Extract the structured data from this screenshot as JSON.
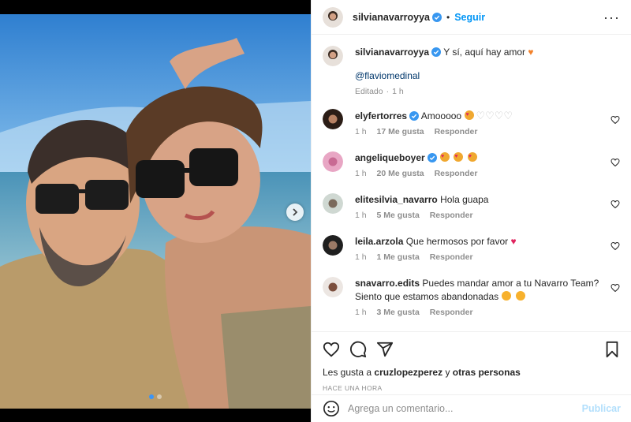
{
  "post": {
    "author": "silvianavarroyya",
    "follow_label": "Seguir",
    "separator": "•",
    "more_label": "···"
  },
  "caption": {
    "author": "silvianavarroyya",
    "text": "Y sí, aquí hay amor",
    "emoji": "orange-heart",
    "mention": "@flaviomedinal",
    "edited_label": "Editado",
    "time": "1 h"
  },
  "comments": [
    {
      "user": "elyfertorres",
      "verified": true,
      "text": "Amooooo",
      "time": "1 h",
      "likes": "17 Me gusta",
      "reply": "Responder"
    },
    {
      "user": "angeliqueboyer",
      "verified": true,
      "text": "",
      "time": "1 h",
      "likes": "20 Me gusta",
      "reply": "Responder"
    },
    {
      "user": "elitesilvia_navarro",
      "verified": false,
      "text": "Hola guapa",
      "time": "1 h",
      "likes": "5 Me gusta",
      "reply": "Responder"
    },
    {
      "user": "leila.arzola",
      "verified": false,
      "text": "Que hermosos por favor",
      "time": "1 h",
      "likes": "1 Me gusta",
      "reply": "Responder"
    },
    {
      "user": "snavarro.edits",
      "verified": false,
      "text": "Puedes mandar amor a tu Navarro Team? Siento que estamos abandonadas",
      "time": "1 h",
      "likes": "3 Me gusta",
      "reply": "Responder"
    }
  ],
  "likes": {
    "prefix": "Les gusta a",
    "user": "cruzlopezperez",
    "conj": "y",
    "others": "otras personas"
  },
  "timestamp": "HACE UNA HORA",
  "composer": {
    "placeholder": "Agrega un comentario...",
    "publish_label": "Publicar"
  },
  "carousel": {
    "slides": 2,
    "active": 1
  },
  "colors": {
    "accent": "#0095f6",
    "verified": "#3897f0",
    "heart": "#e0245e",
    "muted": "#8e8e8e"
  },
  "icons": [
    "verified-icon",
    "more-icon",
    "heart-icon",
    "comment-icon",
    "share-icon",
    "bookmark-icon",
    "emoji-icon",
    "chevron-right-icon"
  ]
}
